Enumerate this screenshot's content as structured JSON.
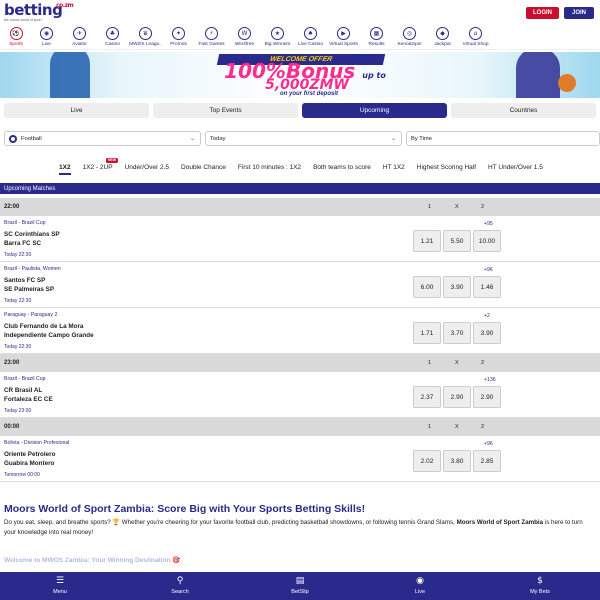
{
  "header": {
    "logo_text": "betting",
    "logo_domain": "co.zm",
    "logo_tagline": "the moors world of sport",
    "login_label": "LOGIN",
    "join_label": "JOIN"
  },
  "categories": [
    {
      "label": "Sports",
      "icon": "⚽",
      "icon_name": "sports-icon",
      "active": true
    },
    {
      "label": "Live",
      "icon": "◉",
      "icon_name": "live-icon"
    },
    {
      "label": "Aviator",
      "icon": "✈",
      "icon_name": "aviator-icon"
    },
    {
      "label": "Casino",
      "icon": "♣",
      "icon_name": "casino-icon"
    },
    {
      "label": "MWOS Leagu..",
      "icon": "♛",
      "icon_name": "league-icon"
    },
    {
      "label": "Promos",
      "icon": "✦",
      "icon_name": "promos-icon"
    },
    {
      "label": "Fast Games",
      "icon": "⚡",
      "icon_name": "fast-games-icon"
    },
    {
      "label": "Win4free",
      "icon": "W",
      "icon_name": "win4free-icon"
    },
    {
      "label": "Big Winners",
      "icon": "★",
      "icon_name": "big-winners-icon"
    },
    {
      "label": "Live Casino",
      "icon": "♠",
      "icon_name": "live-casino-icon"
    },
    {
      "label": "Virtual Sports",
      "icon": "▶",
      "icon_name": "virtual-sports-icon"
    },
    {
      "label": "Results",
      "icon": "▦",
      "icon_name": "results-icon"
    },
    {
      "label": "Keno&Spin",
      "icon": "◎",
      "icon_name": "keno-icon"
    },
    {
      "label": "Jackpot",
      "icon": "◆",
      "icon_name": "jackpot-icon"
    },
    {
      "label": "Virtual Shop",
      "icon": "⌂",
      "icon_name": "virtual-shop-icon"
    }
  ],
  "banner": {
    "tag": "WELCOME OFFER",
    "bonus": "100%Bonus",
    "bonus_suffix": "up to",
    "amount": "5,000ZMW",
    "sub": "on your first deposit"
  },
  "main_tabs": [
    {
      "label": "Live"
    },
    {
      "label": "Top Events"
    },
    {
      "label": "Upcoming",
      "active": true
    },
    {
      "label": "Countries"
    }
  ],
  "filters": {
    "sport": "Football",
    "date": "Today",
    "sort": "By Time"
  },
  "markets": [
    {
      "label": "1X2",
      "active": true
    },
    {
      "label": "1X2 - 2UP",
      "badge": "NEW"
    },
    {
      "label": "Under/Over 2.5"
    },
    {
      "label": "Double Chance"
    },
    {
      "label": "First 10 minutes : 1X2"
    },
    {
      "label": "Both teams to score"
    },
    {
      "label": "HT 1X2"
    },
    {
      "label": "Highest Scoring Half"
    },
    {
      "label": "HT Under/Over 1.5"
    }
  ],
  "upcoming_title": "Upcoming Matches",
  "col_labels": {
    "home": "1",
    "draw": "X",
    "away": "2"
  },
  "time_groups": [
    {
      "time": "22:00",
      "matches": [
        {
          "league": "Brazil - Brazil Cup",
          "team1": "SC Corinthians SP",
          "team2": "Barra FC SC",
          "time": "Today 22:30",
          "more": "+95",
          "odds": [
            "1.21",
            "5.50",
            "10.00"
          ]
        },
        {
          "league": "Brazil - Paulista, Women",
          "team1": "Santos FC SP",
          "team2": "SE Palmeiras SP",
          "time": "Today 22:30",
          "more": "+96",
          "odds": [
            "6.00",
            "3.90",
            "1.46"
          ]
        },
        {
          "league": "Paraguay - Paraguay 2",
          "team1": "Club Fernando de La Mora",
          "team2": "Independiente Campo Grande",
          "time": "Today 22:30",
          "more": "+2",
          "odds": [
            "1.71",
            "3.70",
            "3.90"
          ]
        }
      ]
    },
    {
      "time": "23:00",
      "matches": [
        {
          "league": "Brazil - Brazil Cup",
          "team1": "CR Brasil AL",
          "team2": "Fortaleza EC CE",
          "time": "Today 23:00",
          "more": "+136",
          "odds": [
            "2.37",
            "2.90",
            "2.90"
          ]
        }
      ]
    },
    {
      "time": "00:00",
      "matches": [
        {
          "league": "Bolivia - Division Profesional",
          "team1": "Oriente Petrolero",
          "team2": "Guabira Montero",
          "time": "Tomorrow 00:00",
          "more": "+96",
          "odds": [
            "2.02",
            "3.80",
            "2.85"
          ]
        }
      ]
    }
  ],
  "article": {
    "title": "Moors World of Sport Zambia: Score Big with Your Sports Betting Skills!",
    "body_1": "Do you eat, sleep, and breathe sports? 🏆 Whether you're cheering for your favorite football club, predicting basketball showdowns, or following tennis Grand Slams, ",
    "body_bold": "Moors World of Sport Zambia",
    "body_2": " is here to turn your knowledge into real money!",
    "subheading": "Welcome to MWOS Zambia: Your Winning Destination 🎯"
  },
  "bottom_nav": [
    {
      "label": "Menu",
      "icon": "☰",
      "icon_name": "menu-icon"
    },
    {
      "label": "Search",
      "icon": "⚲",
      "icon_name": "search-icon"
    },
    {
      "label": "BetSlip",
      "icon": "▤",
      "icon_name": "betslip-icon"
    },
    {
      "label": "Live",
      "icon": "◉",
      "icon_name": "live-icon"
    },
    {
      "label": "My Bets",
      "icon": "$",
      "icon_name": "my-bets-icon"
    }
  ]
}
